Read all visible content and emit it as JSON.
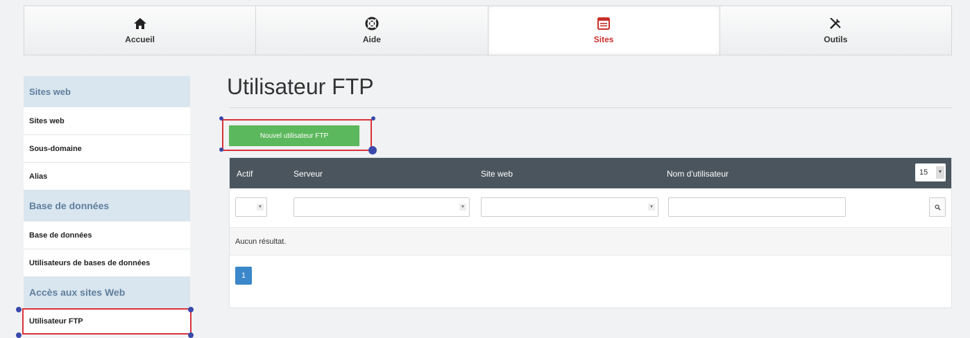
{
  "topnav": {
    "tabs": [
      {
        "label": "Accueil",
        "icon": "home-icon"
      },
      {
        "label": "Aide",
        "icon": "lifebuoy-icon"
      },
      {
        "label": "Sites",
        "icon": "site-window-icon",
        "active": true
      },
      {
        "label": "Outils",
        "icon": "tools-icon"
      }
    ]
  },
  "sidebar": {
    "sections": [
      {
        "title": "Sites web",
        "items": [
          "Sites web",
          "Sous-domaine",
          "Alias"
        ]
      },
      {
        "title": "Base de données",
        "items": [
          "Base de données",
          "Utilisateurs de bases de données"
        ]
      },
      {
        "title": "Accès aux sites Web",
        "items": [
          "Utilisateur FTP"
        ]
      }
    ]
  },
  "main": {
    "title": "Utilisateur FTP",
    "new_button": "Nouvel utilisateur FTP",
    "table": {
      "columns": [
        "Actif",
        "Serveur",
        "Site web",
        "Nom d'utilisateur"
      ],
      "page_size": "15",
      "empty_text": "Aucun résultat.",
      "current_page": "1"
    }
  },
  "colors": {
    "accent": "#c9302c",
    "button_green": "#5cb85c",
    "header_dark": "#4b555d",
    "highlight": "#d9323a"
  }
}
